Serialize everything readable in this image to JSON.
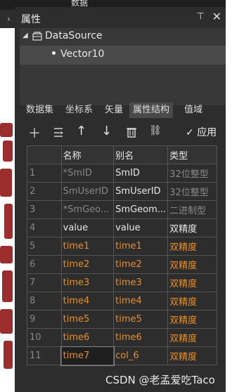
{
  "window": {
    "top_title": "数据"
  },
  "panel": {
    "title": "属性",
    "pin_icon": "pin-icon",
    "close_icon": "close-icon"
  },
  "tree": {
    "root_label": "DataSource",
    "child_label": "Vector10"
  },
  "tabs": [
    {
      "label": "数据集"
    },
    {
      "label": "坐标系"
    },
    {
      "label": "矢量"
    },
    {
      "label": "属性结构",
      "active": true
    },
    {
      "label": "值域"
    }
  ],
  "toolbar": {
    "add_icon": "plus-icon",
    "insert_icon": "insert-field-icon",
    "move_up_icon": "arrow-up-icon",
    "move_down_icon": "arrow-down-icon",
    "delete_icon": "trash-icon",
    "link_icon": "link-icon",
    "apply_label": "应用"
  },
  "table": {
    "headers": [
      "",
      "名称",
      "别名",
      "类型"
    ],
    "rows": [
      {
        "idx": "1",
        "name": "*SmID",
        "alias": "SmID",
        "type": "32位整型",
        "kind": "sys"
      },
      {
        "idx": "2",
        "name": "SmUserID",
        "alias": "SmUserID",
        "type": "32位整型",
        "kind": "sys"
      },
      {
        "idx": "3",
        "name": "*SmGeo...",
        "alias": "SmGeom...",
        "type": "二进制型",
        "kind": "sys"
      },
      {
        "idx": "4",
        "name": "value",
        "alias": "value",
        "type": "双精度",
        "kind": "norm"
      },
      {
        "idx": "5",
        "name": "time1",
        "alias": "time1",
        "type": "双精度",
        "kind": "orange"
      },
      {
        "idx": "6",
        "name": "time2",
        "alias": "time2",
        "type": "双精度",
        "kind": "orange"
      },
      {
        "idx": "7",
        "name": "time3",
        "alias": "time3",
        "type": "双精度",
        "kind": "orange"
      },
      {
        "idx": "8",
        "name": "time4",
        "alias": "time4",
        "type": "双精度",
        "kind": "orange"
      },
      {
        "idx": "9",
        "name": "time5",
        "alias": "time5",
        "type": "双精度",
        "kind": "orange"
      },
      {
        "idx": "10",
        "name": "time6",
        "alias": "time6",
        "type": "双精度",
        "kind": "orange"
      },
      {
        "idx": "11",
        "name": "time7",
        "alias": "col_6",
        "type": "双精度",
        "kind": "orange"
      }
    ]
  },
  "watermark": "CSDN @老孟爱吃Taco",
  "colors": {
    "orange": "#e58f2a",
    "panel_bg": "#2d2d2d",
    "map_red": "#9b2d2d"
  }
}
